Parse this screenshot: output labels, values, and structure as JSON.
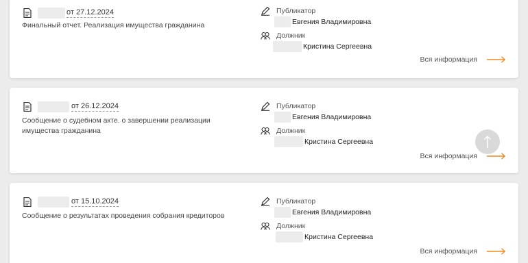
{
  "colors": {
    "accent": "#f08c1e",
    "masked": "#ececec"
  },
  "icons": {
    "document": "document-icon",
    "publisher": "pencil-icon",
    "debtor": "people-icon",
    "more": "arrow-right-icon",
    "scroll_top": "arrow-up-icon"
  },
  "cards": [
    {
      "date": "от 27.12.2024",
      "description": "Финальный отчет. Реализация имущества гражданина",
      "publisher_label": "Публикатор",
      "publisher_value": "Евгения Владимировна",
      "debtor_label": "Должник",
      "debtor_value": "Кристина Сергеевна",
      "more_label": "Вся информация"
    },
    {
      "date": "от 26.12.2024",
      "description": "Сообщение о судебном акте. о завершении реализации имущества гражданина",
      "publisher_label": "Публикатор",
      "publisher_value": "Евгения Владимировна",
      "debtor_label": "Должник",
      "debtor_value": "Кристина Сергеевна",
      "more_label": "Вся информация"
    },
    {
      "date": "от 15.10.2024",
      "description": "Сообщение о результатах проведения собрания кредиторов",
      "publisher_label": "Публикатор",
      "publisher_value": "Евгения Владимировна",
      "debtor_label": "Должник",
      "debtor_value": "Кристина Сергеевна",
      "more_label": "Вся информация"
    }
  ]
}
